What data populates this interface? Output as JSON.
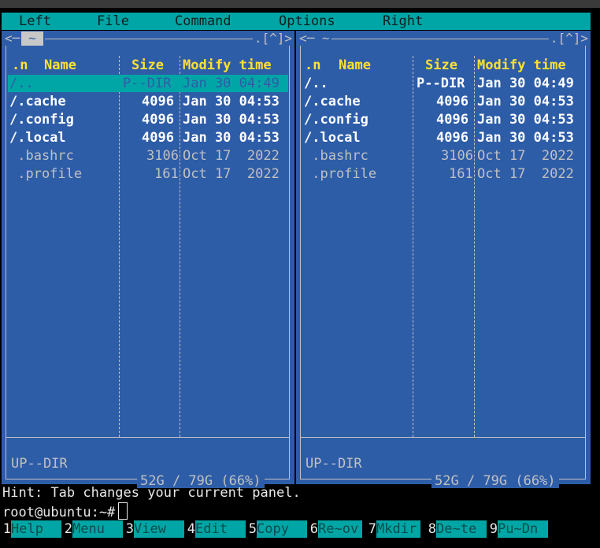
{
  "menu": {
    "items": [
      "Left",
      "File",
      "Command",
      "Options",
      "Right"
    ]
  },
  "left_panel": {
    "path": "~",
    "controls": ".[^]>",
    "headers": {
      "n": ".n",
      "name": "Name",
      "size": "Size",
      "modify": "Modify time"
    },
    "rows": [
      {
        "name": "/..",
        "size": "P--DIR",
        "modify": "Jan 30 04:49"
      },
      {
        "name": "/.cache",
        "size": "4096",
        "modify": "Jan 30 04:53"
      },
      {
        "name": "/.config",
        "size": "4096",
        "modify": "Jan 30 04:53"
      },
      {
        "name": "/.local",
        "size": "4096",
        "modify": "Jan 30 04:53"
      },
      {
        "name": " .bashrc",
        "size": "3106",
        "modify": "Oct 17  2022"
      },
      {
        "name": " .profile",
        "size": "161",
        "modify": "Oct 17  2022"
      }
    ],
    "status": "UP--DIR",
    "disk": "52G / 79G (66%)"
  },
  "right_panel": {
    "path": "~",
    "controls": ".[^]>",
    "headers": {
      "n": ".n",
      "name": "Name",
      "size": "Size",
      "modify": "Modify time"
    },
    "rows": [
      {
        "name": "/..",
        "size": "P--DIR",
        "modify": "Jan 30 04:49"
      },
      {
        "name": "/.cache",
        "size": "4096",
        "modify": "Jan 30 04:53"
      },
      {
        "name": "/.config",
        "size": "4096",
        "modify": "Jan 30 04:53"
      },
      {
        "name": "/.local",
        "size": "4096",
        "modify": "Jan 30 04:53"
      },
      {
        "name": " .bashrc",
        "size": "3106",
        "modify": "Oct 17  2022"
      },
      {
        "name": " .profile",
        "size": "161",
        "modify": "Oct 17  2022"
      }
    ],
    "status": "UP--DIR",
    "disk": "52G / 79G (66%)"
  },
  "hint": "Hint: Tab changes your current panel.",
  "prompt": "root@ubuntu:~#",
  "fkeys": [
    {
      "num": "1",
      "label": "Help"
    },
    {
      "num": "2",
      "label": "Menu"
    },
    {
      "num": "3",
      "label": "View"
    },
    {
      "num": "4",
      "label": "Edit"
    },
    {
      "num": "5",
      "label": "Copy"
    },
    {
      "num": "6",
      "label": "Re~ov"
    },
    {
      "num": "7",
      "label": "Mkdir"
    },
    {
      "num": "8",
      "label": "De~te"
    },
    {
      "num": "9",
      "label": "Pu~Dn"
    }
  ],
  "colors": {
    "panel_bg": "#2e5da8",
    "accent": "#00a5a5",
    "header": "#ffe033"
  }
}
